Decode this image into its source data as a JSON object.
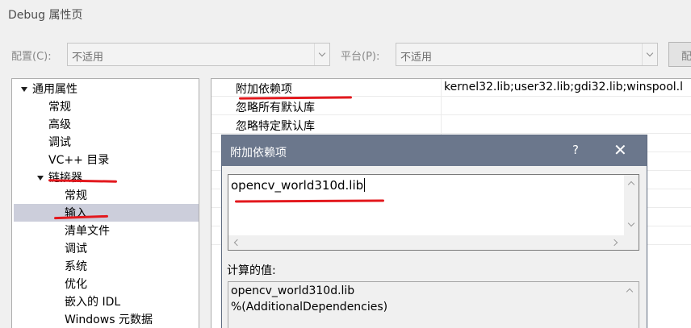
{
  "window": {
    "title": "Debug 属性页"
  },
  "config_bar": {
    "config_label": "配置(C):",
    "config_value": "不适用",
    "platform_label": "平台(P):",
    "platform_value": "不适用",
    "manager_button": "配"
  },
  "tree": {
    "items": [
      {
        "label": "通用属性",
        "expanded": true
      },
      {
        "label": "常规"
      },
      {
        "label": "高级"
      },
      {
        "label": "调试"
      },
      {
        "label": "VC++ 目录"
      },
      {
        "label": "链接器",
        "expanded": true
      },
      {
        "label": "常规"
      },
      {
        "label": "输入",
        "selected": true
      },
      {
        "label": "清单文件"
      },
      {
        "label": "调试"
      },
      {
        "label": "系统"
      },
      {
        "label": "优化"
      },
      {
        "label": "嵌入的 IDL"
      },
      {
        "label": "Windows 元数据"
      }
    ]
  },
  "property_grid": {
    "rows": [
      {
        "name": "附加依赖项",
        "value": "kernel32.lib;user32.lib;gdi32.lib;winspool.l"
      },
      {
        "name": "忽略所有默认库",
        "value": ""
      },
      {
        "name": "忽略特定默认库",
        "value": ""
      }
    ]
  },
  "dialog": {
    "title": "附加依赖项",
    "help": "?",
    "close": "✕",
    "input_text": "opencv_world310d.lib",
    "calc_label": "计算的值:",
    "calc_lines": [
      "opencv_world310d.lib",
      "%(AdditionalDependencies)"
    ]
  },
  "colors": {
    "annotation_red": "#e3191e",
    "dialog_title_bg": "#6b778c",
    "selection_bg": "#cccedb"
  }
}
